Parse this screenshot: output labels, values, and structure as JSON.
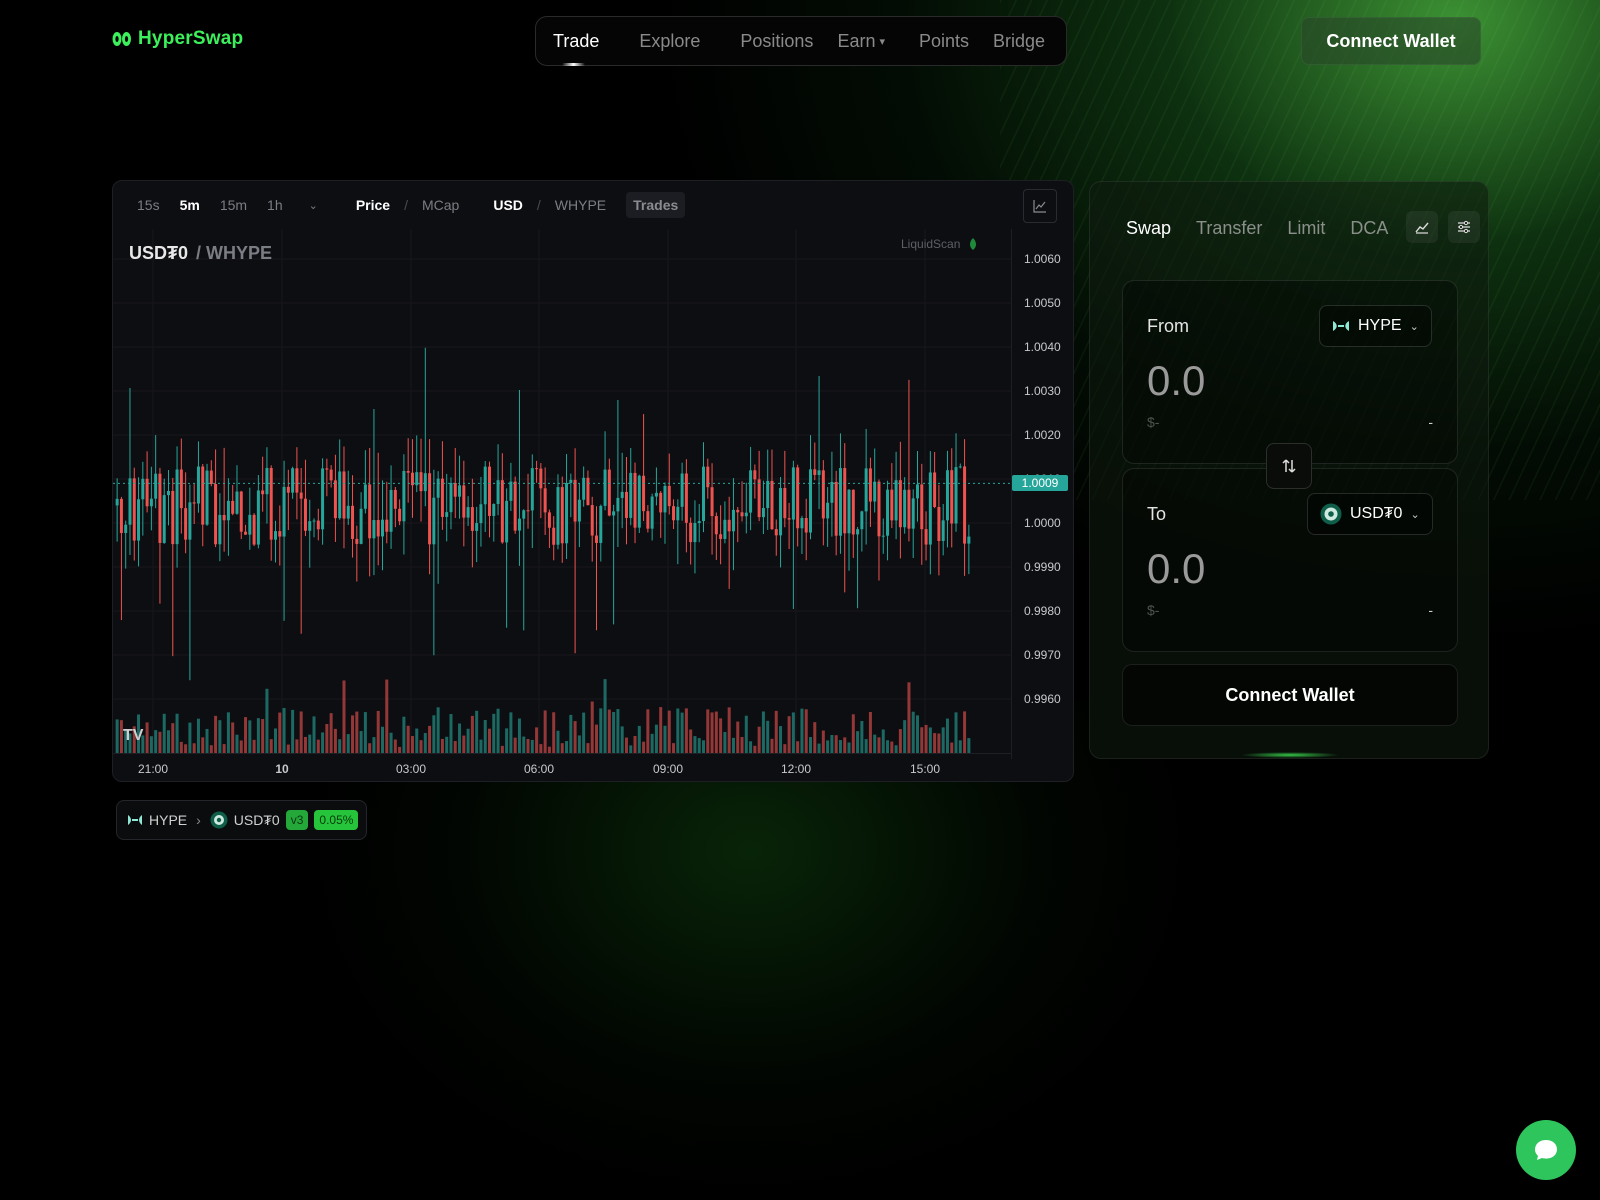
{
  "header": {
    "brand": "HyperSwap",
    "nav": [
      {
        "label": "Trade",
        "active": true
      },
      {
        "label": "Explore"
      },
      {
        "label": "Positions"
      },
      {
        "label": "Earn",
        "dropdown": true
      },
      {
        "label": "Points"
      },
      {
        "label": "Bridge"
      }
    ],
    "connect_wallet": "Connect Wallet"
  },
  "chart_toolbar": {
    "intervals": [
      "15s",
      "5m",
      "15m",
      "1h"
    ],
    "active_interval": "5m",
    "price": "Price",
    "mcap": "MCap",
    "usd": "USD",
    "whype": "WHYPE",
    "trades": "Trades",
    "separator": "/"
  },
  "chart_header": {
    "base": "USD₮0",
    "quote": "/ WHYPE",
    "attribution": "LiquidScan"
  },
  "chart_data": {
    "type": "candlestick",
    "title": "USD₮0 / WHYPE",
    "interval": "5m",
    "y_ticks": [
      "1.0060",
      "1.0050",
      "1.0040",
      "1.0030",
      "1.0020",
      "1.0010",
      "1.0000",
      "0.9990",
      "0.9980",
      "0.9970",
      "0.9960"
    ],
    "ylim": [
      0.9955,
      1.0065
    ],
    "x_ticks": [
      {
        "label": "21:00"
      },
      {
        "label": "10",
        "bold": true
      },
      {
        "label": "03:00"
      },
      {
        "label": "06:00"
      },
      {
        "label": "09:00"
      },
      {
        "label": "12:00"
      },
      {
        "label": "15:00"
      }
    ],
    "current_price": "1.0009",
    "up_color": "#26a69a",
    "down_color": "#ef5350",
    "candle_count": 200,
    "series_note_visible": false
  },
  "route": {
    "from": "HYPE",
    "to": "USD₮0",
    "version": "v3",
    "fee": "0.05%"
  },
  "swap": {
    "tabs": [
      "Swap",
      "Transfer",
      "Limit",
      "DCA"
    ],
    "active_tab": "Swap",
    "from_label": "From",
    "to_label": "To",
    "from_token": "HYPE",
    "to_token": "USD₮0",
    "from_amount": "0.0",
    "to_amount": "0.0",
    "from_usd": "$-",
    "to_usd": "$-",
    "from_balance": "-",
    "to_balance": "-",
    "connect_wallet": "Connect Wallet"
  },
  "colors": {
    "brand": "#3bf05a",
    "accent_badge": "#26c43a",
    "chat": "#2ec55c"
  }
}
